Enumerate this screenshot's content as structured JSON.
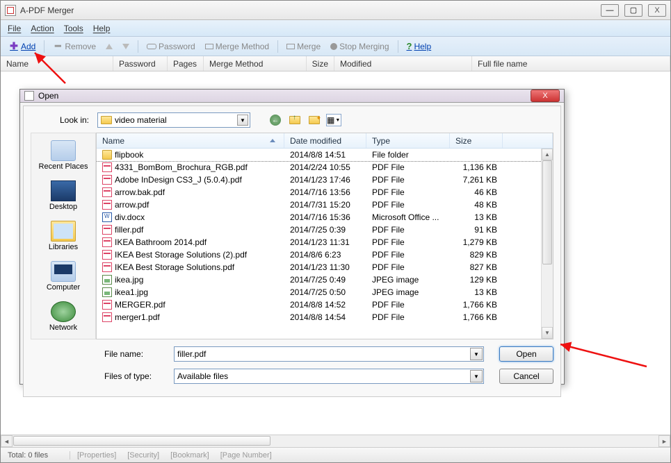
{
  "window": {
    "title": "A-PDF Merger",
    "min": "—",
    "max": "▢",
    "close": "X"
  },
  "menubar": [
    "File",
    "Action",
    "Tools",
    "Help"
  ],
  "toolbar": {
    "add": "Add",
    "remove": "Remove",
    "password": "Password",
    "merge_method": "Merge Method",
    "merge": "Merge",
    "stop": "Stop Merging",
    "help": "Help"
  },
  "columns": {
    "name": "Name",
    "password": "Password",
    "pages": "Pages",
    "merge_method": "Merge Method",
    "size": "Size",
    "modified": "Modified",
    "full": "Full file name"
  },
  "status": {
    "total": "Total: 0 files",
    "props": "[Properties]",
    "security": "[Security]",
    "bookmark": "[Bookmark]",
    "pagenum": "[Page Number]"
  },
  "dialog": {
    "title": "Open",
    "lookin_label": "Look in:",
    "lookin_value": "video material",
    "places": [
      "Recent Places",
      "Desktop",
      "Libraries",
      "Computer",
      "Network"
    ],
    "columns": {
      "name": "Name",
      "date": "Date modified",
      "type": "Type",
      "size": "Size"
    },
    "files": [
      {
        "icon": "folder",
        "name": "flipbook",
        "date": "2014/8/8 14:51",
        "type": "File folder",
        "size": ""
      },
      {
        "icon": "pdf",
        "name": "4331_BomBom_Brochura_RGB.pdf",
        "date": "2014/2/24 10:55",
        "type": "PDF File",
        "size": "1,136 KB"
      },
      {
        "icon": "pdf",
        "name": "Adobe InDesign CS3_J (5.0.4).pdf",
        "date": "2014/1/23 17:46",
        "type": "PDF File",
        "size": "7,261 KB"
      },
      {
        "icon": "pdf",
        "name": "arrow.bak.pdf",
        "date": "2014/7/16 13:56",
        "type": "PDF File",
        "size": "46 KB"
      },
      {
        "icon": "pdf",
        "name": "arrow.pdf",
        "date": "2014/7/31 15:20",
        "type": "PDF File",
        "size": "48 KB"
      },
      {
        "icon": "doc",
        "name": "div.docx",
        "date": "2014/7/16 15:36",
        "type": "Microsoft Office ...",
        "size": "13 KB"
      },
      {
        "icon": "pdf",
        "name": "filler.pdf",
        "date": "2014/7/25 0:39",
        "type": "PDF File",
        "size": "91 KB"
      },
      {
        "icon": "pdf",
        "name": "IKEA Bathroom 2014.pdf",
        "date": "2014/1/23 11:31",
        "type": "PDF File",
        "size": "1,279 KB"
      },
      {
        "icon": "pdf",
        "name": "IKEA Best Storage Solutions (2).pdf",
        "date": "2014/8/6 6:23",
        "type": "PDF File",
        "size": "829 KB"
      },
      {
        "icon": "pdf",
        "name": "IKEA Best Storage Solutions.pdf",
        "date": "2014/1/23 11:30",
        "type": "PDF File",
        "size": "827 KB"
      },
      {
        "icon": "img",
        "name": "ikea.jpg",
        "date": "2014/7/25 0:49",
        "type": "JPEG image",
        "size": "129 KB"
      },
      {
        "icon": "img",
        "name": "ikea1.jpg",
        "date": "2014/7/25 0:50",
        "type": "JPEG image",
        "size": "13 KB"
      },
      {
        "icon": "pdf",
        "name": "MERGER.pdf",
        "date": "2014/8/8 14:52",
        "type": "PDF File",
        "size": "1,766 KB"
      },
      {
        "icon": "pdf",
        "name": "merger1.pdf",
        "date": "2014/8/8 14:54",
        "type": "PDF File",
        "size": "1,766 KB"
      }
    ],
    "filename_label": "File name:",
    "filename_value": "filler.pdf",
    "filetype_label": "Files of type:",
    "filetype_value": "Available files",
    "open_btn": "Open",
    "cancel_btn": "Cancel"
  }
}
